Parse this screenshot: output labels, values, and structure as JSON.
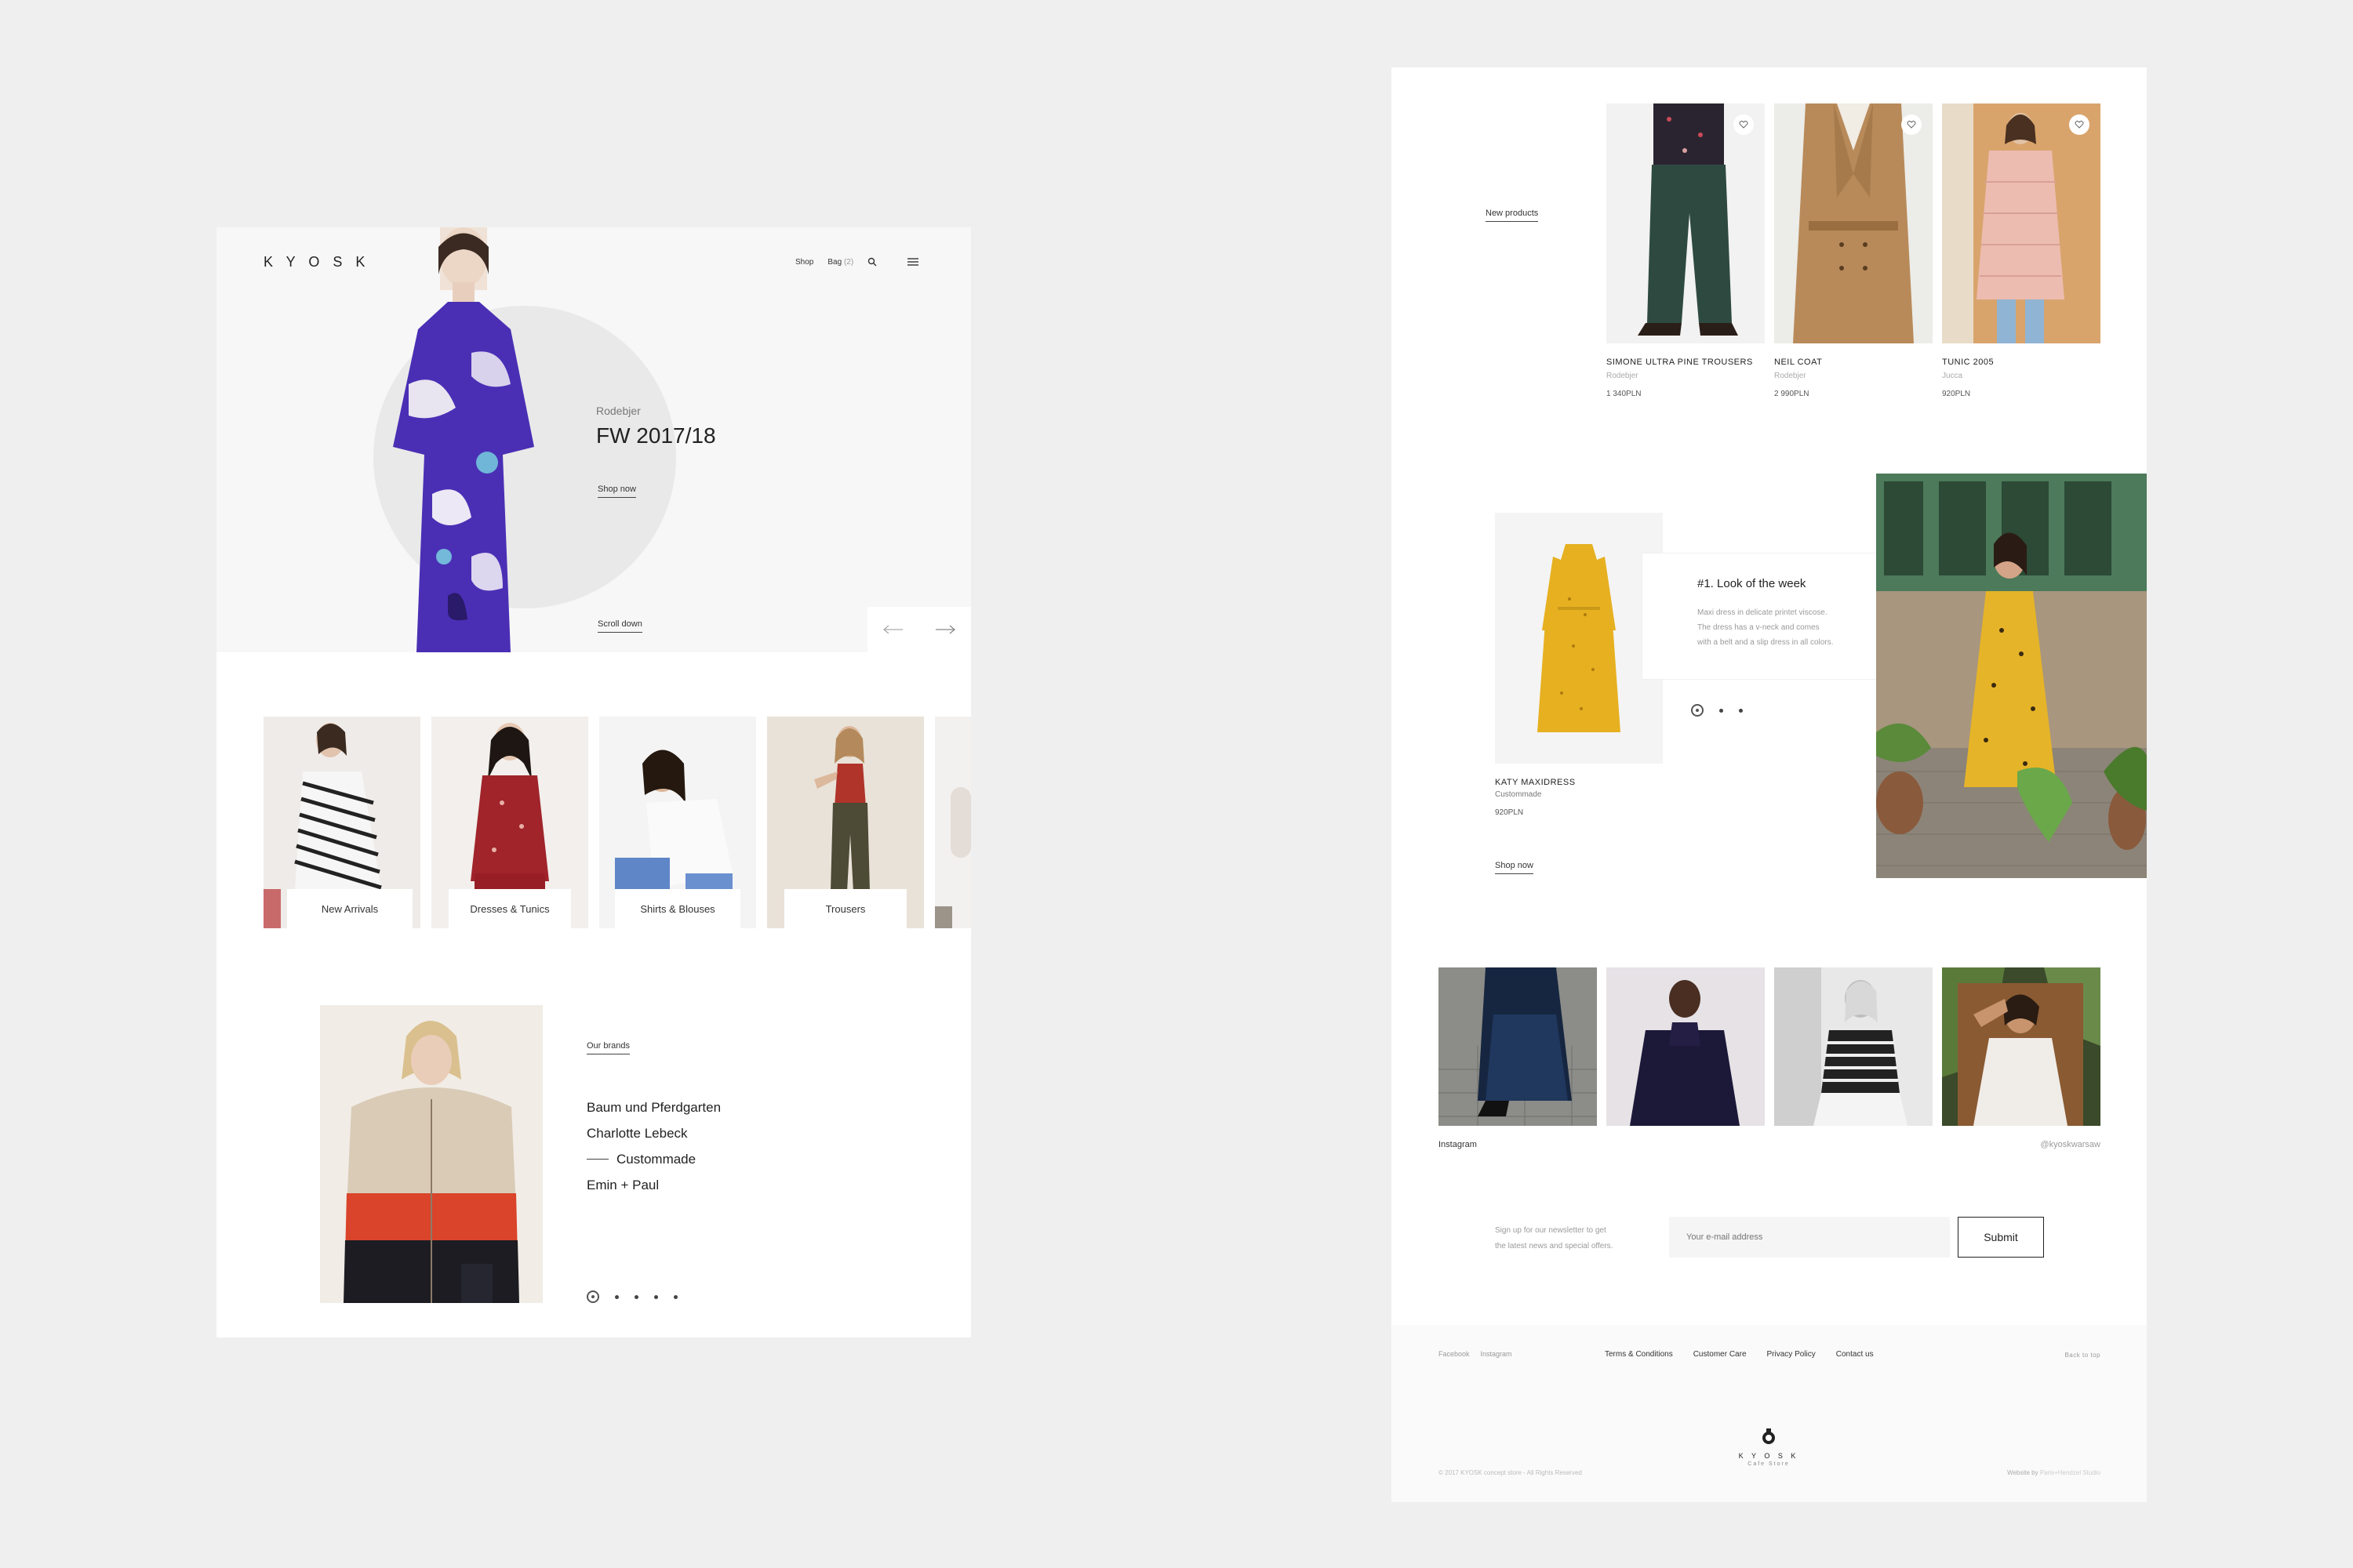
{
  "left": {
    "logo": "K Y O S K",
    "nav": {
      "shop": "Shop",
      "bag": "Bag",
      "bag_count": "(2)"
    },
    "hero": {
      "brand": "Rodebjer",
      "title": "FW 2017/18",
      "cta": "Shop now",
      "scroll": "Scroll down"
    },
    "categories": [
      {
        "label": "New Arrivals"
      },
      {
        "label": "Dresses & Tunics"
      },
      {
        "label": "Shirts & Blouses"
      },
      {
        "label": "Trousers"
      }
    ],
    "brands": {
      "heading": "Our brands",
      "items": [
        "Baum und Pferdgarten",
        "Charlotte Lebeck",
        "Custommade",
        "Emin + Paul"
      ]
    }
  },
  "right": {
    "new_products": {
      "heading": "New products",
      "items": [
        {
          "name": "SIMONE ULTRA PINE TROUSERS",
          "brand": "Rodebjer",
          "price": "1 340PLN"
        },
        {
          "name": "NEIL COAT",
          "brand": "Rodebjer",
          "price": "2 990PLN"
        },
        {
          "name": "TUNIC 2005",
          "brand": "Jucca",
          "price": "920PLN"
        }
      ]
    },
    "look": {
      "title": "#1. Look of the week",
      "desc_1": "Maxi dress in delicate printet viscose.",
      "desc_2": "The dress has a v-neck and comes",
      "desc_3": "with a belt and a slip dress in all colors.",
      "product_name": "KATY MAXIDRESS",
      "product_brand": "Custommade",
      "product_price": "920PLN",
      "cta": "Shop now"
    },
    "instagram": {
      "label": "Instagram",
      "handle": "@kyoskwarsaw"
    },
    "newsletter": {
      "text_1": "Sign up for our newsletter to get",
      "text_2": "the latest news and special offers.",
      "placeholder": "Your e-mail address",
      "submit": "Submit"
    },
    "footer": {
      "social": [
        "Facebook",
        "Instagram"
      ],
      "links": [
        "Terms & Conditions",
        "Customer Care",
        "Privacy Policy",
        "Contact us"
      ],
      "back_to_top": "Back to top",
      "copyright": "© 2017 KYOSK concept store - All Rights Reserved",
      "logo": "K Y O S K",
      "logo_sub": "Cafe Store",
      "credit_prefix": "Website by",
      "credit_name": "Paris+Hendzel Studio"
    }
  },
  "colors": {
    "accent": "#5a3fb3",
    "background": "#efefef",
    "panel": "#ffffff"
  }
}
